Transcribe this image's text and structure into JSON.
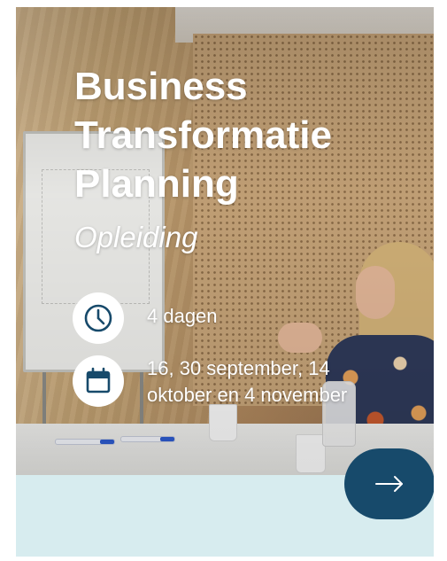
{
  "course": {
    "title_line1": "Business",
    "title_line2": "Transformatie",
    "title_line3": "Planning",
    "subtitle": "Opleiding"
  },
  "details": {
    "duration": {
      "icon": "clock-icon",
      "text": "4 dagen"
    },
    "dates": {
      "icon": "calendar-icon",
      "text_line1": "16, 30 september, 14",
      "text_line2": "oktober en 4 november"
    }
  },
  "cta": {
    "icon": "arrow-right-icon"
  },
  "colors": {
    "icon_blue": "#174a6b",
    "button_bg": "#174a6b",
    "footer_bg": "#d7ecef",
    "text": "#ffffff"
  }
}
